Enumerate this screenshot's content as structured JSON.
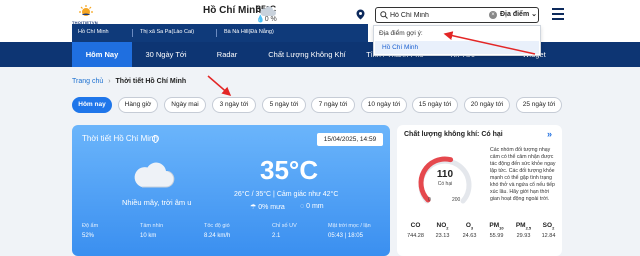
{
  "header": {
    "logo_text": "THOITIETVN",
    "city": "Hồ Chí Minh",
    "temp": "35°C",
    "rain": "0 %",
    "search": {
      "value": "Hồ Chí Minh",
      "select_label": "Địa điểm"
    }
  },
  "quick_cities": [
    "Hồ Chí Minh",
    "Thị xã Sa Pa(Lào Cai)",
    "Bà Nà Hill(Đà Nẵng)"
  ],
  "dropdown": {
    "title": "Địa điểm gợi ý:",
    "items": [
      "Hồ Chí Minh"
    ]
  },
  "nav": [
    "Hôm Nay",
    "30 Ngày Tới",
    "Radar",
    "Chất Lượng Không Khí",
    "Tỉnh / Thành Phố",
    "Tin Tức",
    "Widget"
  ],
  "breadcrumb": {
    "home": "Trang chủ",
    "separator": "›",
    "current": "Thời tiết Hồ Chí Minh"
  },
  "tabs": [
    "Hôm nay",
    "Hàng giờ",
    "Ngày mai",
    "3 ngày tới",
    "5 ngày tới",
    "7 ngày tới",
    "10 ngày tới",
    "15 ngày tới",
    "20 ngày tới",
    "25 ngày tới"
  ],
  "weather": {
    "title": "Thời tiết Hồ Chí Minh",
    "date": "15/04/2025, 14:59",
    "temp": "35°C",
    "desc": "Nhiều mây, trời âm u",
    "feel": "26°C / 35°C | Cảm giác như 42°C",
    "rain": "0% mưa",
    "snow": "0 mm",
    "stats": [
      {
        "label": "Độ ẩm",
        "value": "52%"
      },
      {
        "label": "Tầm nhìn",
        "value": "10 km"
      },
      {
        "label": "Tốc độ gió",
        "value": "8.24 km/h"
      },
      {
        "label": "Chỉ số UV",
        "value": "2.1"
      },
      {
        "label": "Mặt trời mọc / lặn",
        "value": "05:43 | 18:05"
      }
    ]
  },
  "aqi": {
    "title": "Chất lượng không khí: Có hại",
    "value": "110",
    "label": "Có hại",
    "min": "0",
    "max": "200",
    "level_fraction": 0.55,
    "description": "Các nhóm đối tượng nhạy cảm có thể cảm nhận được tác động đến sức khỏe ngay lập tức. Các đối tượng khỏe mạnh có thể gặp tình trạng khó thở và ngứa cổ nếu tiếp xúc lâu. Hãy giới hạn thời gian hoạt động ngoài trời.",
    "pollutants": [
      {
        "name": "CO",
        "sub": "",
        "value": "744.28"
      },
      {
        "name": "NO",
        "sub": "2",
        "value": "23.13"
      },
      {
        "name": "O",
        "sub": "3",
        "value": "24.63"
      },
      {
        "name": "PM",
        "sub": "10",
        "value": "55.99"
      },
      {
        "name": "PM",
        "sub": "2.5",
        "value": "29.93"
      },
      {
        "name": "SO",
        "sub": "2",
        "value": "12.84"
      }
    ]
  },
  "colors": {
    "nav_bg": "#0d3573",
    "accent": "#1f76ea",
    "aqi_gauge": "#e5484d",
    "annotation": "#e32626"
  }
}
